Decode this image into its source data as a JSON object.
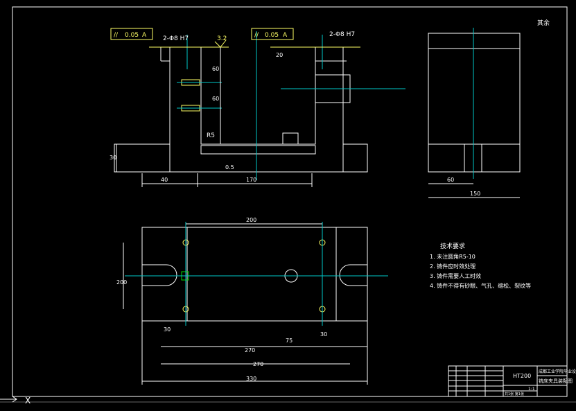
{
  "colors": {
    "background": "#000000",
    "outline": "#ffffff",
    "annotation": "#ffff66",
    "centerline": "#00c8c8",
    "hole": "#00e000"
  },
  "front_view": {
    "tolerance_left": {
      "symbol": "//",
      "value": "0.05",
      "datum": "A"
    },
    "tolerance_right": {
      "symbol": "//",
      "value": "0.05",
      "datum": "A"
    },
    "hole_note_left": "2-Φ8 H7",
    "hole_note_right": "2-Φ8 H7",
    "roughness": "3.2",
    "fillet": "R5",
    "dims": [
      "40",
      "170",
      "30",
      "60",
      "60",
      "20",
      "0.5"
    ]
  },
  "side_view": {
    "roughness_other": "其余",
    "dims": [
      "60",
      "150"
    ]
  },
  "top_view": {
    "dims": [
      "200",
      "200",
      "30",
      "75",
      "30",
      "270",
      "270",
      "330"
    ]
  },
  "tech_requirements": {
    "title": "技术要求",
    "items": [
      "1. 未注圆角R5-10",
      "2. 铸件应时效处理",
      "3. 铸件需要人工时效",
      "4. 铸件不得有砂眼、气孔、缩松、裂纹等"
    ]
  },
  "title_block": {
    "material": "HT200",
    "school": "成都工业学院毕业设计",
    "drawing_name": "铣床夹具装配图",
    "scale": "1:1",
    "sheet": "共1张 第1张"
  },
  "ucs": {
    "x_label": "X"
  }
}
